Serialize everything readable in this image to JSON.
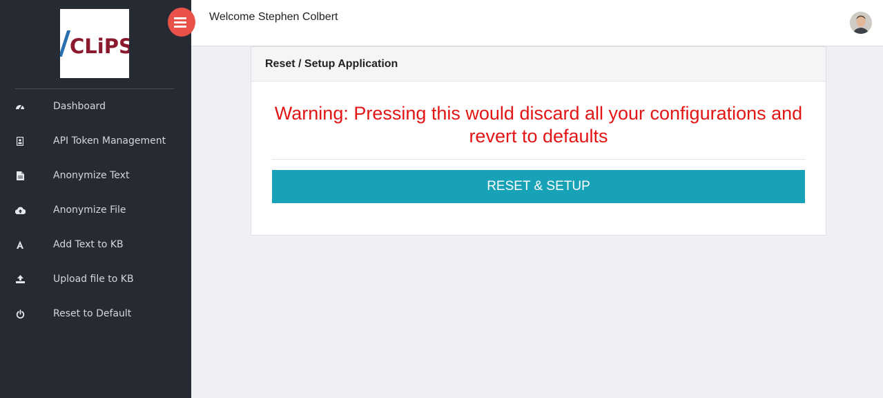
{
  "sidebar": {
    "logo": {
      "text": "CLiPS",
      "colors": {
        "slash": "#2a6fb0",
        "text": "#8b1a2e"
      }
    },
    "items": [
      {
        "label": "Dashboard",
        "icon": "dashboard-gauge-icon"
      },
      {
        "label": "API Token Management",
        "icon": "id-badge-icon"
      },
      {
        "label": "Anonymize Text",
        "icon": "file-text-icon"
      },
      {
        "label": "Anonymize File",
        "icon": "cloud-upload-icon"
      },
      {
        "label": "Add Text to KB",
        "icon": "font-a-icon"
      },
      {
        "label": "Upload file to KB",
        "icon": "upload-icon"
      },
      {
        "label": "Reset to Default",
        "icon": "power-icon"
      }
    ]
  },
  "header": {
    "welcome": "Welcome Stephen Colbert",
    "menu_toggle_icon": "menu-icon",
    "avatar_icon": "user-avatar"
  },
  "card": {
    "title": "Reset / Setup Application",
    "warning": "Warning: Pressing this would discard all your configurations and revert to defaults",
    "button_label": "RESET & SETUP"
  },
  "colors": {
    "sidebar_bg": "#262a33",
    "accent_red": "#e8524a",
    "warning_red": "#e31414",
    "button_teal": "#17a2b8"
  }
}
